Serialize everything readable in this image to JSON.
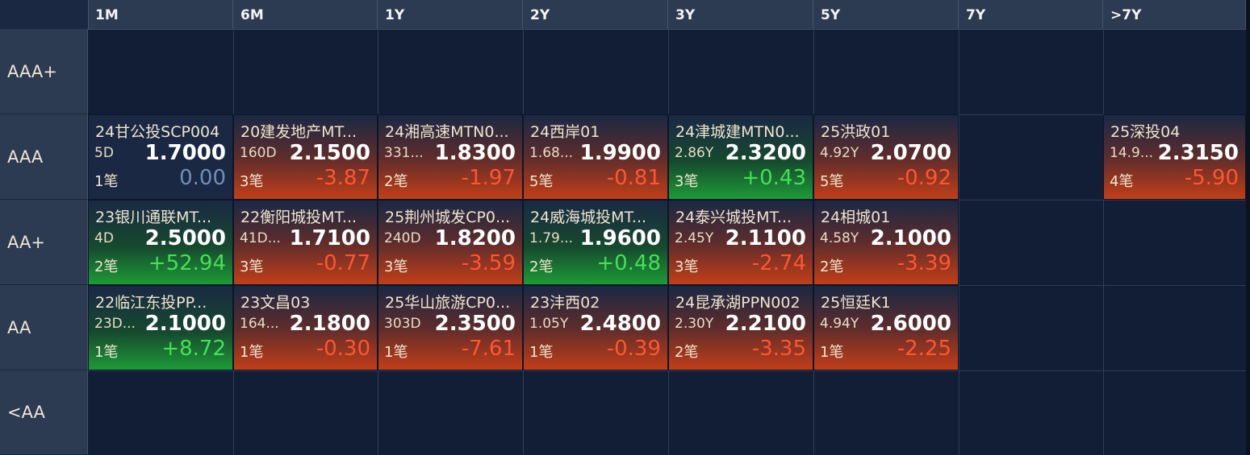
{
  "columns": [
    "1M",
    "6M",
    "1Y",
    "2Y",
    "3Y",
    "5Y",
    "7Y",
    ">7Y"
  ],
  "rows": [
    "AAA+",
    "AAA",
    "AA+",
    "AA",
    "<AA"
  ],
  "colors": {
    "header_bg": "#2c3a52",
    "grid_bg": "#111e36",
    "positive_change": "#45e055",
    "negative_change": "#ff5530",
    "zero_change": "#6f8fb8"
  },
  "cells": [
    {
      "row": 1,
      "col": 0,
      "name": "24甘公投SCP004",
      "term": "5D",
      "price": "1.7000",
      "count": "1笔",
      "change": "0.00",
      "trend": "neutral"
    },
    {
      "row": 1,
      "col": 1,
      "name": "20建发地产MT...",
      "term": "160D",
      "price": "2.1500",
      "count": "3笔",
      "change": "-3.87",
      "trend": "down"
    },
    {
      "row": 1,
      "col": 2,
      "name": "24湘高速MTN0...",
      "term": "331...",
      "price": "1.8300",
      "count": "2笔",
      "change": "-1.97",
      "trend": "down"
    },
    {
      "row": 1,
      "col": 3,
      "name": "24西岸01",
      "term": "1.68...",
      "price": "1.9900",
      "count": "5笔",
      "change": "-0.81",
      "trend": "down"
    },
    {
      "row": 1,
      "col": 4,
      "name": "24津城建MTN0...",
      "term": "2.86Y",
      "price": "2.3200",
      "count": "3笔",
      "change": "+0.43",
      "trend": "up"
    },
    {
      "row": 1,
      "col": 5,
      "name": "25洪政01",
      "term": "4.92Y",
      "price": "2.0700",
      "count": "5笔",
      "change": "-0.92",
      "trend": "down"
    },
    {
      "row": 1,
      "col": 7,
      "name": "25深投04",
      "term": "14.9...",
      "price": "2.3150",
      "count": "4笔",
      "change": "-5.90",
      "trend": "down"
    },
    {
      "row": 2,
      "col": 0,
      "name": "23银川通联MT...",
      "term": "4D",
      "price": "2.5000",
      "count": "2笔",
      "change": "+52.94",
      "trend": "up"
    },
    {
      "row": 2,
      "col": 1,
      "name": "22衡阳城投MT...",
      "term": "41D...",
      "price": "1.7100",
      "count": "3笔",
      "change": "-0.77",
      "trend": "down"
    },
    {
      "row": 2,
      "col": 2,
      "name": "25荆州城发CP0...",
      "term": "240D",
      "price": "1.8200",
      "count": "3笔",
      "change": "-3.59",
      "trend": "down"
    },
    {
      "row": 2,
      "col": 3,
      "name": "24威海城投MT...",
      "term": "1.79...",
      "price": "1.9600",
      "count": "2笔",
      "change": "+0.48",
      "trend": "up"
    },
    {
      "row": 2,
      "col": 4,
      "name": "24泰兴城投MT...",
      "term": "2.45Y",
      "price": "2.1100",
      "count": "3笔",
      "change": "-2.74",
      "trend": "down"
    },
    {
      "row": 2,
      "col": 5,
      "name": "24相城01",
      "term": "4.58Y",
      "price": "2.1000",
      "count": "2笔",
      "change": "-3.39",
      "trend": "down"
    },
    {
      "row": 3,
      "col": 0,
      "name": "22临江东投PP...",
      "term": "23D...",
      "price": "2.1000",
      "count": "1笔",
      "change": "+8.72",
      "trend": "up"
    },
    {
      "row": 3,
      "col": 1,
      "name": "23文昌03",
      "term": "164...",
      "price": "2.1800",
      "count": "1笔",
      "change": "-0.30",
      "trend": "down"
    },
    {
      "row": 3,
      "col": 2,
      "name": "25华山旅游CP0...",
      "term": "303D",
      "price": "2.3500",
      "count": "1笔",
      "change": "-7.61",
      "trend": "down"
    },
    {
      "row": 3,
      "col": 3,
      "name": "23沣西02",
      "term": "1.05Y",
      "price": "2.4800",
      "count": "1笔",
      "change": "-0.39",
      "trend": "down"
    },
    {
      "row": 3,
      "col": 4,
      "name": "24昆承湖PPN002",
      "term": "2.30Y",
      "price": "2.2100",
      "count": "2笔",
      "change": "-3.35",
      "trend": "down"
    },
    {
      "row": 3,
      "col": 5,
      "name": "25恒廷K1",
      "term": "4.94Y",
      "price": "2.6000",
      "count": "1笔",
      "change": "-2.25",
      "trend": "down"
    }
  ]
}
